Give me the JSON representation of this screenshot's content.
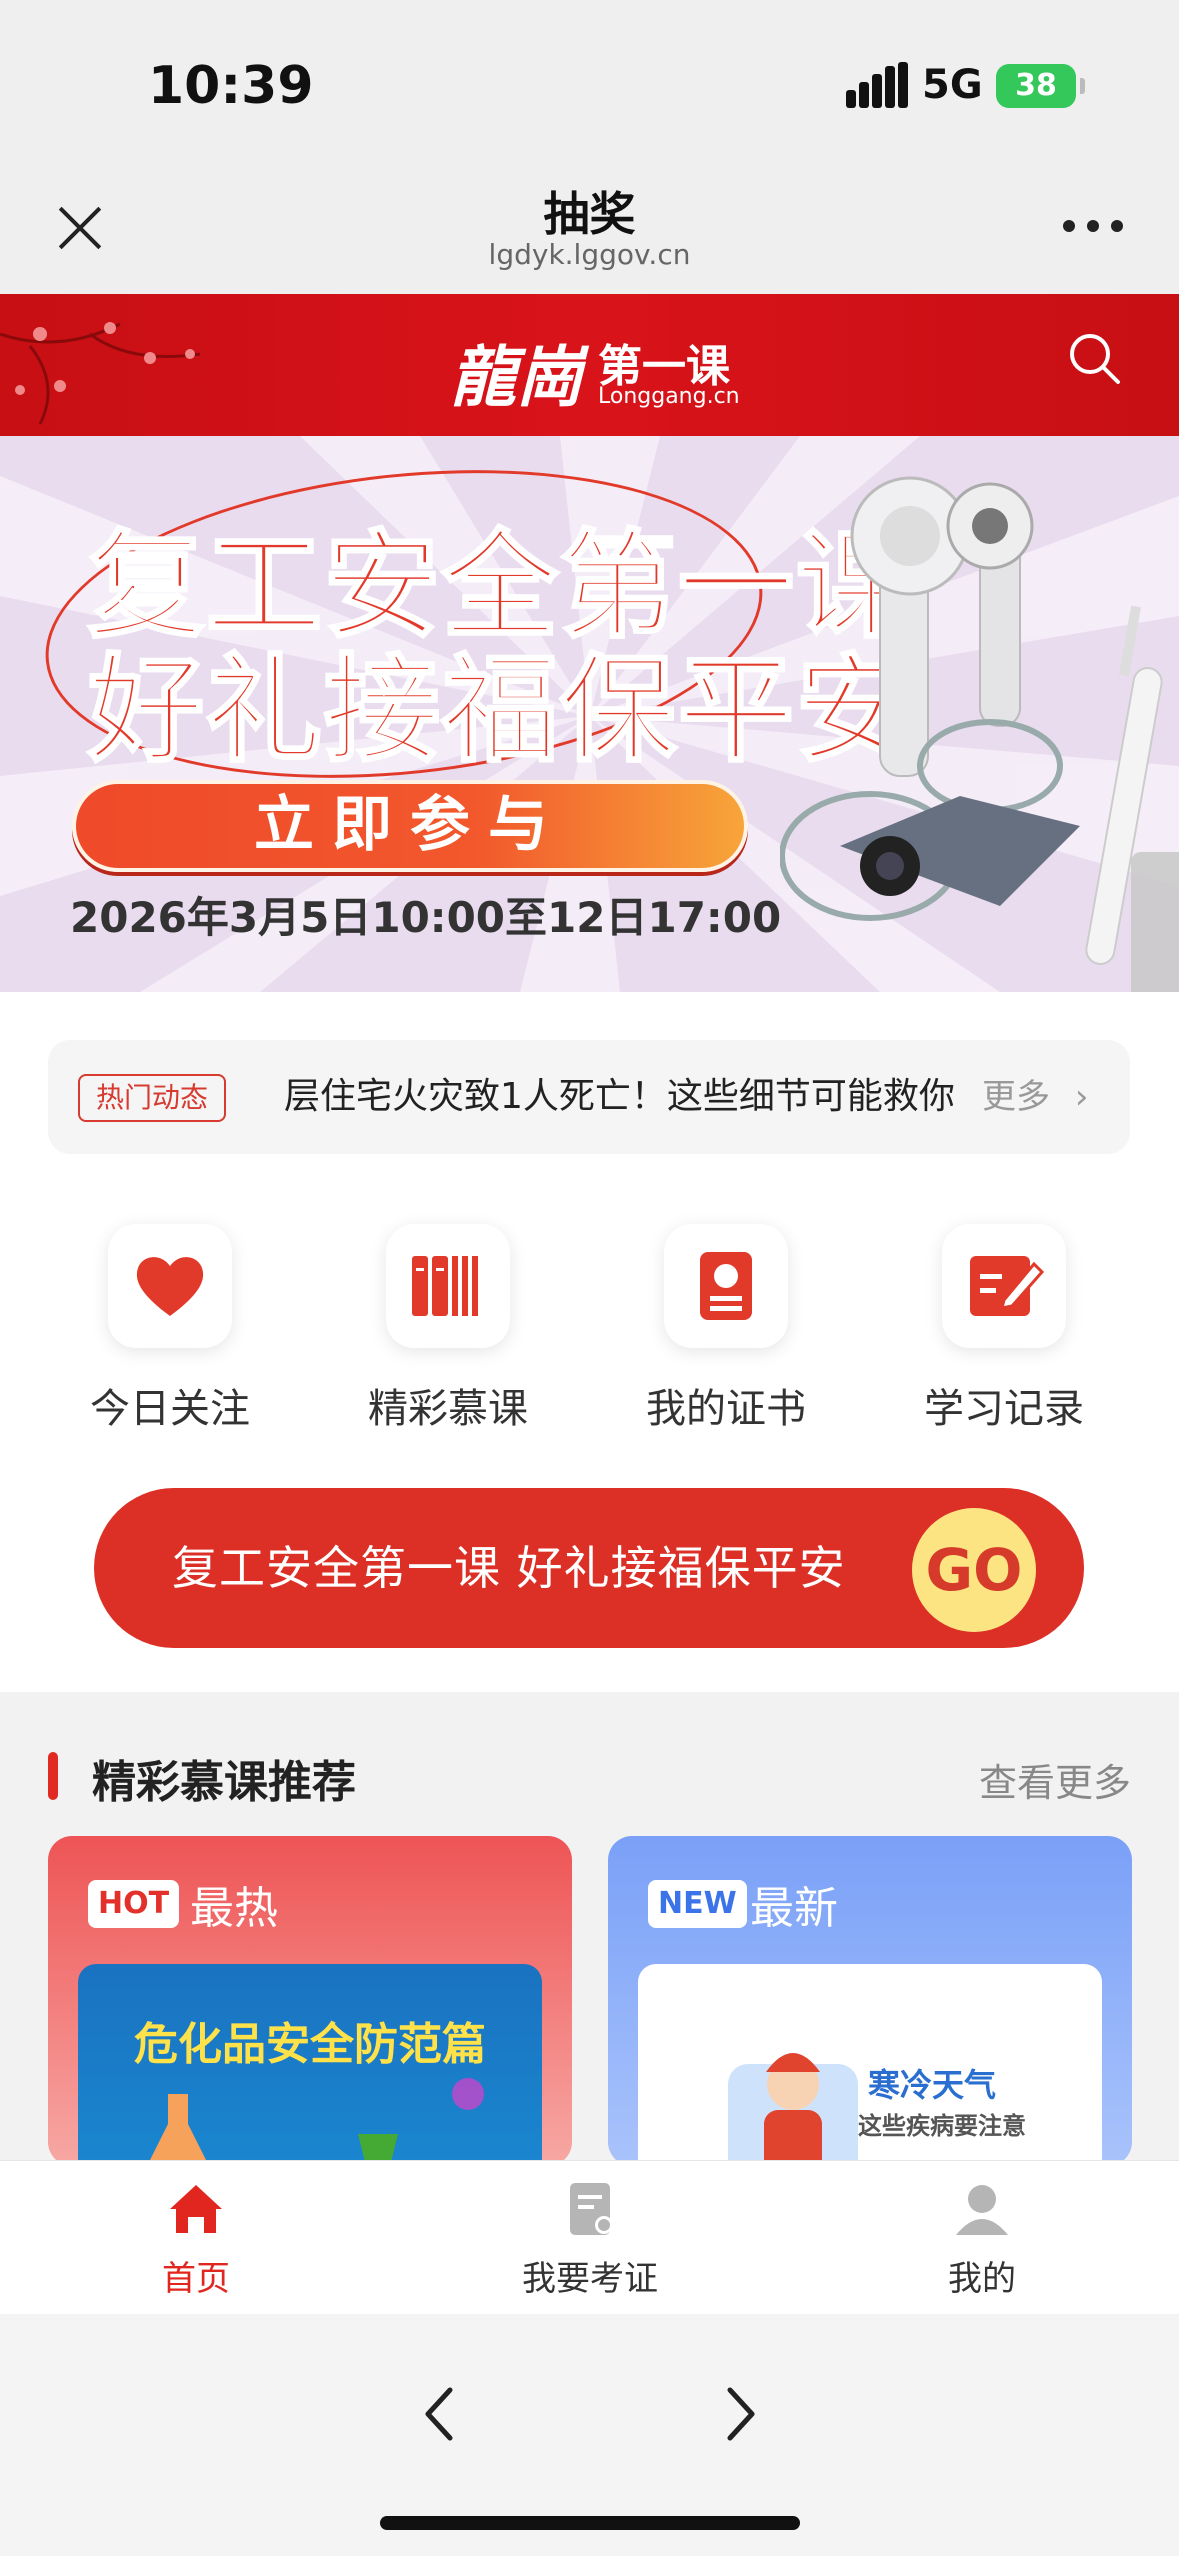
{
  "status": {
    "time": "10:39",
    "network": "5G",
    "battery": "38"
  },
  "nav": {
    "title": "抽奖",
    "url": "lgdyk.lggov.cn"
  },
  "site_header": {
    "logo_cn": "龍崗",
    "logo_sub": "第一课",
    "logo_en": "Longgang.cn"
  },
  "banner": {
    "line1": "复工安全第一课",
    "line2": "好礼接福保平安",
    "button": "立即参与",
    "date": "2026年3月5日10:00至12日17:00"
  },
  "ticker": {
    "tag": "热门动态",
    "text": "层住宅火灾致1人死亡！这些细节可能救你",
    "more": "更多"
  },
  "quick_links": [
    {
      "label": "今日关注",
      "icon": "heart-icon"
    },
    {
      "label": "精彩慕课",
      "icon": "books-icon"
    },
    {
      "label": "我的证书",
      "icon": "certificate-icon"
    },
    {
      "label": "学习记录",
      "icon": "edit-note-icon"
    }
  ],
  "promo": {
    "text": "复工安全第一课 好礼接福保平安",
    "go": "GO"
  },
  "recommend": {
    "title": "精彩慕课推荐",
    "more": "查看更多",
    "hot": {
      "badge": "HOT",
      "label": "最热",
      "thumb_title": "危化品安全防范篇"
    },
    "new": {
      "badge": "NEW",
      "label": "最新",
      "thumb_title": "寒冷天气",
      "thumb_sub": "这些疾病要注意"
    }
  },
  "tabbar": [
    {
      "label": "首页",
      "icon": "home-icon",
      "active": true
    },
    {
      "label": "我要考证",
      "icon": "exam-icon",
      "active": false
    },
    {
      "label": "我的",
      "icon": "user-icon",
      "active": false
    }
  ],
  "colors": {
    "brand_red": "#dc3027",
    "header_red": "#d9131a",
    "go_yellow": "#fde483"
  }
}
